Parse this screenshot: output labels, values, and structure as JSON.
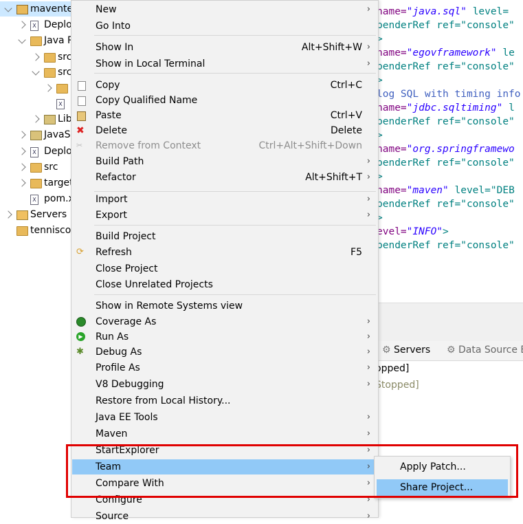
{
  "tree": {
    "items": [
      {
        "label": "mavente",
        "chev": "d",
        "icon": "proj"
      },
      {
        "label": "Deplo",
        "chev": "r",
        "icon": "file"
      },
      {
        "label": "Java R",
        "chev": "d",
        "icon": "folder"
      },
      {
        "label": "src,",
        "chev": "r",
        "icon": "folder"
      },
      {
        "label": "src,",
        "chev": "d",
        "icon": "folder"
      },
      {
        "label": "",
        "chev": "r",
        "icon": "folder"
      },
      {
        "label": "",
        "chev": "",
        "icon": "file"
      },
      {
        "label": "Lib",
        "chev": "r",
        "icon": "lib"
      },
      {
        "label": "JavaSc",
        "chev": "r",
        "icon": "lib"
      },
      {
        "label": "Deplo",
        "chev": "r",
        "icon": "file"
      },
      {
        "label": "src",
        "chev": "r",
        "icon": "folder"
      },
      {
        "label": "target",
        "chev": "r",
        "icon": "folder"
      },
      {
        "label": "pom.x",
        "chev": "",
        "icon": "file"
      },
      {
        "label": "Servers",
        "chev": "r",
        "icon": "srv"
      },
      {
        "label": "tenniscor",
        "chev": "",
        "icon": "folder"
      }
    ]
  },
  "editor": {
    "lines": [
      {
        "a": "name=",
        "s": "\"java.sql\"",
        "t": " level="
      },
      {
        "a": "",
        "s": "",
        "t": "penderRef ref=\"console\""
      },
      {
        "a": "",
        "s": "",
        "t": ">"
      },
      {
        "a": "name=",
        "s": "\"egovframework\"",
        "t": " le"
      },
      {
        "a": "",
        "s": "",
        "t": "penderRef ref=\"console\""
      },
      {
        "a": "",
        "s": "",
        "t": ">"
      },
      {
        "a": "",
        "s": "",
        "t": "log SQL with timing info"
      },
      {
        "a": "name=",
        "s": "\"jdbc.sqltiming\"",
        "t": " l"
      },
      {
        "a": "",
        "s": "",
        "t": "penderRef ref=\"console\""
      },
      {
        "a": "",
        "s": "",
        "t": ">"
      },
      {
        "a": "name=",
        "s": "\"org.springframewo",
        "t": ""
      },
      {
        "a": "",
        "s": "",
        "t": "penderRef ref=\"console\""
      },
      {
        "a": "",
        "s": "",
        "t": ">"
      },
      {
        "a": "name=",
        "s": "\"maven\"",
        "t": " level=\"DEB"
      },
      {
        "a": "",
        "s": "",
        "t": "penderRef ref=\"console\""
      },
      {
        "a": "",
        "s": "",
        "t": ">"
      },
      {
        "a": "evel=",
        "s": "\"INFO\"",
        "t": ">"
      },
      {
        "a": "",
        "s": "",
        "t": "penderRef ref=\"console\""
      }
    ]
  },
  "panel": {
    "tabs": [
      {
        "label": "Servers"
      },
      {
        "label": "Data Source E"
      }
    ],
    "rows": [
      "opped]",
      "Stopped]"
    ]
  },
  "menu": {
    "items": [
      {
        "label": "New",
        "shortcut": "",
        "arrow": true,
        "icon": "",
        "disabled": false
      },
      {
        "label": "Go Into",
        "shortcut": "",
        "arrow": false,
        "icon": "",
        "disabled": false
      },
      {
        "sep": true
      },
      {
        "label": "Show In",
        "shortcut": "Alt+Shift+W",
        "arrow": true,
        "icon": "",
        "disabled": false
      },
      {
        "label": "Show in Local Terminal",
        "shortcut": "",
        "arrow": true,
        "icon": "",
        "disabled": false
      },
      {
        "sep": true
      },
      {
        "label": "Copy",
        "shortcut": "Ctrl+C",
        "arrow": false,
        "icon": "copy-icon",
        "disabled": false
      },
      {
        "label": "Copy Qualified Name",
        "shortcut": "",
        "arrow": false,
        "icon": "copy-icon",
        "disabled": false
      },
      {
        "label": "Paste",
        "shortcut": "Ctrl+V",
        "arrow": false,
        "icon": "paste-icon",
        "disabled": false
      },
      {
        "label": "Delete",
        "shortcut": "Delete",
        "arrow": false,
        "icon": "delete-icon",
        "disabled": false
      },
      {
        "label": "Remove from Context",
        "shortcut": "Ctrl+Alt+Shift+Down",
        "arrow": false,
        "icon": "remove-icon",
        "disabled": true
      },
      {
        "label": "Build Path",
        "shortcut": "",
        "arrow": true,
        "icon": "",
        "disabled": false
      },
      {
        "label": "Refactor",
        "shortcut": "Alt+Shift+T",
        "arrow": true,
        "icon": "",
        "disabled": false
      },
      {
        "sep": true
      },
      {
        "label": "Import",
        "shortcut": "",
        "arrow": true,
        "icon": "",
        "disabled": false
      },
      {
        "label": "Export",
        "shortcut": "",
        "arrow": true,
        "icon": "",
        "disabled": false
      },
      {
        "sep": true
      },
      {
        "label": "Build Project",
        "shortcut": "",
        "arrow": false,
        "icon": "",
        "disabled": false
      },
      {
        "label": "Refresh",
        "shortcut": "F5",
        "arrow": false,
        "icon": "refresh-icon",
        "disabled": false
      },
      {
        "label": "Close Project",
        "shortcut": "",
        "arrow": false,
        "icon": "",
        "disabled": false
      },
      {
        "label": "Close Unrelated Projects",
        "shortcut": "",
        "arrow": false,
        "icon": "",
        "disabled": false
      },
      {
        "sep": true
      },
      {
        "label": "Show in Remote Systems view",
        "shortcut": "",
        "arrow": false,
        "icon": "",
        "disabled": false
      },
      {
        "label": "Coverage As",
        "shortcut": "",
        "arrow": true,
        "icon": "coverage-icon",
        "disabled": false
      },
      {
        "label": "Run As",
        "shortcut": "",
        "arrow": true,
        "icon": "run-icon",
        "disabled": false
      },
      {
        "label": "Debug As",
        "shortcut": "",
        "arrow": true,
        "icon": "debug-icon",
        "disabled": false
      },
      {
        "label": "Profile As",
        "shortcut": "",
        "arrow": true,
        "icon": "",
        "disabled": false
      },
      {
        "label": "V8 Debugging",
        "shortcut": "",
        "arrow": true,
        "icon": "",
        "disabled": false
      },
      {
        "label": "Restore from Local History...",
        "shortcut": "",
        "arrow": false,
        "icon": "",
        "disabled": false
      },
      {
        "label": "Java EE Tools",
        "shortcut": "",
        "arrow": true,
        "icon": "",
        "disabled": false
      },
      {
        "label": "Maven",
        "shortcut": "",
        "arrow": true,
        "icon": "",
        "disabled": false
      },
      {
        "label": "StartExplorer",
        "shortcut": "",
        "arrow": true,
        "icon": "",
        "disabled": false
      },
      {
        "label": "Team",
        "shortcut": "",
        "arrow": true,
        "icon": "",
        "disabled": false,
        "highlighted": true
      },
      {
        "label": "Compare With",
        "shortcut": "",
        "arrow": true,
        "icon": "",
        "disabled": false
      },
      {
        "label": "Configure",
        "shortcut": "",
        "arrow": true,
        "icon": "",
        "disabled": false
      },
      {
        "label": "Source",
        "shortcut": "",
        "arrow": true,
        "icon": "",
        "disabled": false
      }
    ]
  },
  "submenu": {
    "items": [
      {
        "label": "Apply Patch...",
        "highlighted": false
      },
      {
        "label": "Share Project...",
        "highlighted": true
      }
    ]
  },
  "colors": {
    "highlight": "#91c9f7",
    "annotation": "#e00000"
  }
}
